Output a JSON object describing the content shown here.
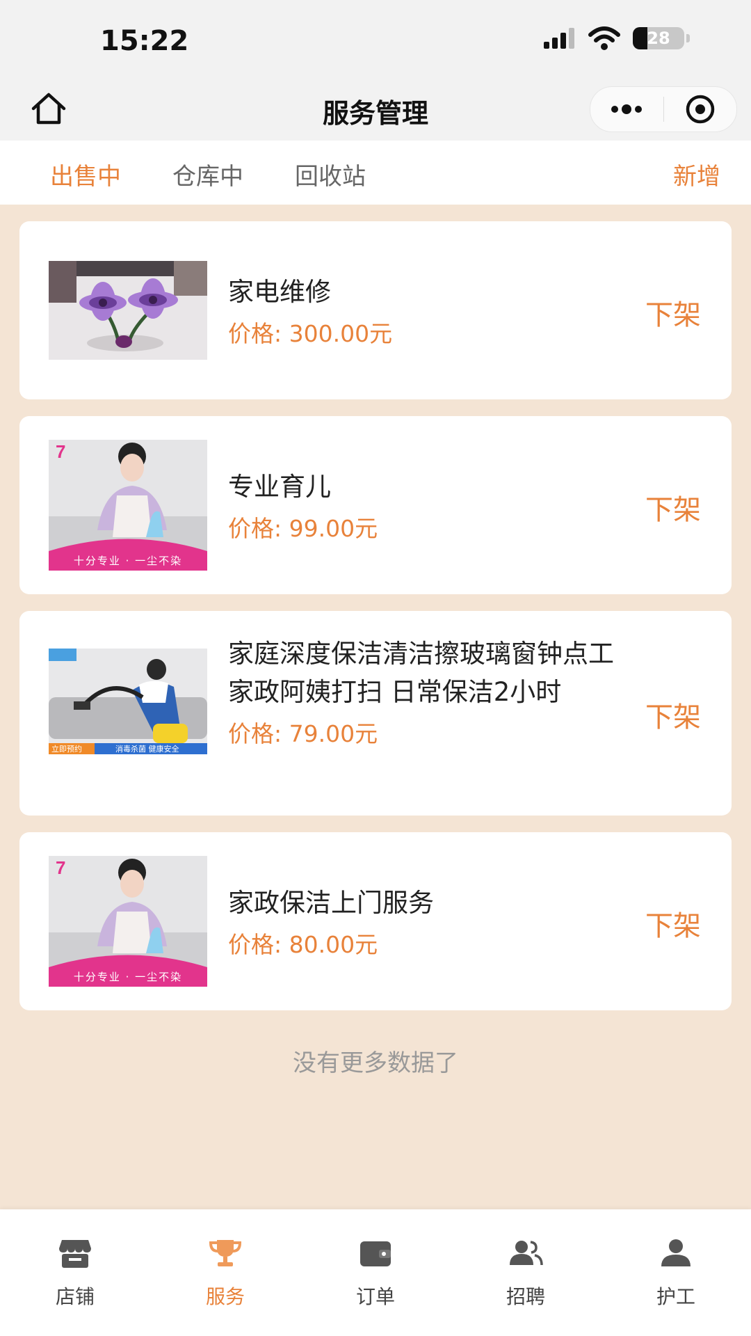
{
  "status_bar": {
    "time": "15:22",
    "battery": "28"
  },
  "nav": {
    "title": "服务管理"
  },
  "tabs": [
    {
      "label": "出售中",
      "active": true
    },
    {
      "label": "仓库中",
      "active": false
    },
    {
      "label": "回收站",
      "active": false
    }
  ],
  "add_label": "新增",
  "services": [
    {
      "title": "家电维修",
      "price": "价格: 300.00元",
      "action": "下架",
      "image": "purple-flowers-photo"
    },
    {
      "title": "专业育儿",
      "price": "价格: 99.00元",
      "action": "下架",
      "image": "housekeeper-cleaning-photo",
      "image_texts": {
        "badge": "7",
        "banner": "十分专业 · 一尘不染"
      }
    },
    {
      "title": "家庭深度保洁清洁擦玻璃窗钟点工家政阿姨打扫 日常保洁2小时",
      "price": "价格: 79.00元",
      "action": "下架",
      "image": "vacuum-cleaning-photo",
      "image_texts": {
        "left": "立即预约",
        "right": "消毒杀菌 健康安全"
      }
    },
    {
      "title": "家政保洁上门服务",
      "price": "价格: 80.00元",
      "action": "下架",
      "image": "housekeeper-cleaning-photo",
      "image_texts": {
        "badge": "7",
        "banner": "十分专业 · 一尘不染"
      }
    }
  ],
  "no_more_text": "没有更多数据了",
  "tabbar": [
    {
      "label": "店铺",
      "icon": "store-icon",
      "active": false
    },
    {
      "label": "服务",
      "icon": "trophy-icon",
      "active": true
    },
    {
      "label": "订单",
      "icon": "wallet-icon",
      "active": false
    },
    {
      "label": "招聘",
      "icon": "people-icon",
      "active": false
    },
    {
      "label": "护工",
      "icon": "person-icon",
      "active": false
    }
  ],
  "colors": {
    "accent": "#e8823a",
    "background": "#f4e4d4"
  }
}
